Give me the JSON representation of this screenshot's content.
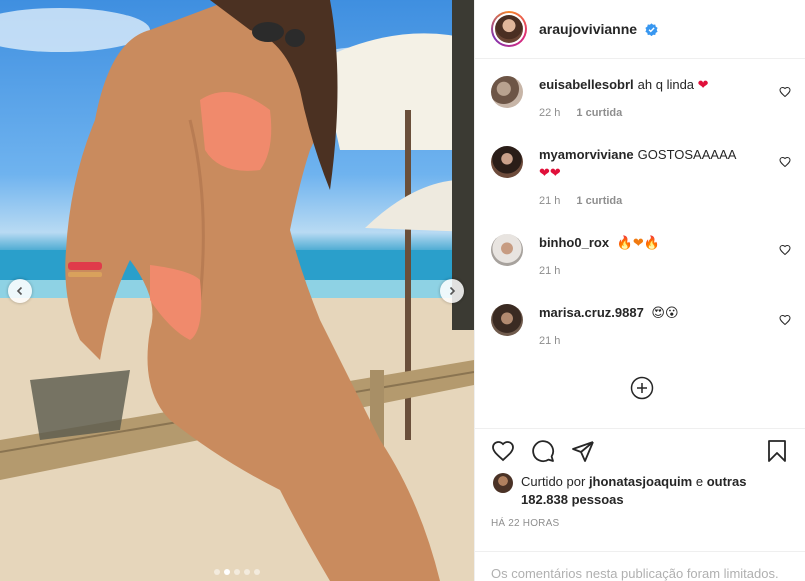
{
  "post": {
    "author": "araujovivianne",
    "verified": true,
    "carousel": {
      "total_slides": 5,
      "current_slide": 2
    }
  },
  "comments": [
    {
      "user": "euisabellesobrl",
      "text": "ah q linda",
      "emoji": "❤",
      "time": "22 h",
      "likes": "1 curtida"
    },
    {
      "user": "myamorviviane",
      "text": "GOSTOSAAAAA",
      "emoji": "❤❤",
      "time": "21 h",
      "likes": "1 curtida"
    },
    {
      "user": "binho0_rox",
      "text": "",
      "emoji": "🔥❤🔥",
      "time": "21 h",
      "likes": ""
    },
    {
      "user": "marisa.cruz.9887",
      "text": "",
      "emoji": "😍😮",
      "time": "21 h",
      "likes": ""
    }
  ],
  "likes": {
    "prefix": "Curtido por",
    "user": "jhonatasjoaquim",
    "connector": "e",
    "others": "outras 182.838 pessoas"
  },
  "timestamp": "HÁ 22 HORAS",
  "comments_limited": "Os comentários nesta publicação foram limitados.",
  "colors": {
    "verified": "#3897f0",
    "heart": "#ed4956",
    "border": "#efefef",
    "muted": "#8e8e8e"
  },
  "icons": [
    "chevron-left-icon",
    "chevron-right-icon",
    "verified-badge-icon",
    "heart-outline-icon",
    "add-circle-icon",
    "comment-icon",
    "share-icon",
    "bookmark-icon"
  ]
}
